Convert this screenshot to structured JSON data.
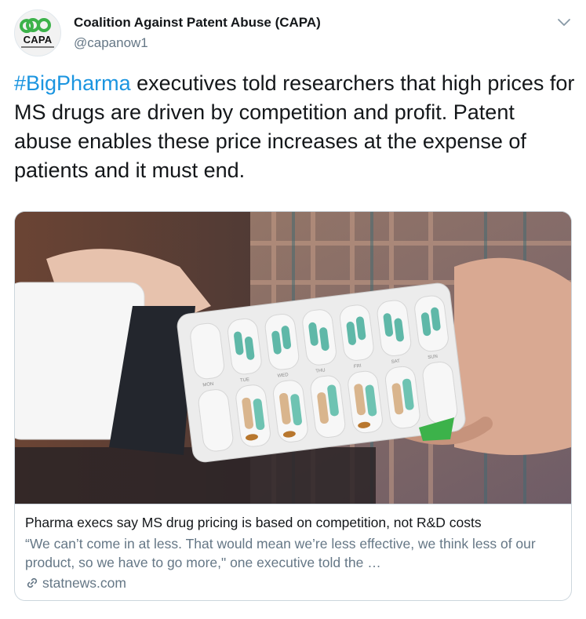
{
  "author": {
    "name": "Coalition Against Patent Abuse (CAPA)",
    "handle": "@capanow1",
    "avatar_text": "CAPA"
  },
  "tweet": {
    "hashtag": "#BigPharma",
    "text": " executives told researchers that high prices for MS drugs are driven by competition and profit. Patent abuse enables these price increases at the expense of patients and it must end."
  },
  "card": {
    "image_desc": "pill-organizer-photo",
    "title": "Pharma execs say MS drug pricing is based on competition, not R&D costs",
    "description": "“We can’t come in at less. That would mean we’re less effective, we think less of our product, so we have to go more,\" one executive told the …",
    "domain": "statnews.com",
    "days": [
      "MON",
      "TUE",
      "WED",
      "THU",
      "FRI",
      "SAT",
      "SUN"
    ]
  },
  "colors": {
    "link": "#1b95e0",
    "secondary_text": "#657786",
    "border": "#ccd6dd",
    "brand_green": "#3cb24a"
  }
}
